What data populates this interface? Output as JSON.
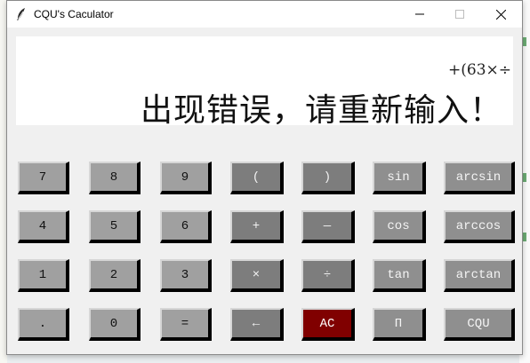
{
  "window": {
    "title": "CQU's Caculator",
    "controls": {
      "minimize": "—",
      "maximize": "☐",
      "close": "✕"
    }
  },
  "display": {
    "expression": "+(63×÷",
    "result": "出现错误，请重新输入！"
  },
  "keys": {
    "row1": [
      "7",
      "8",
      "9",
      "(",
      ")",
      "sin",
      "arcsin"
    ],
    "row2": [
      "4",
      "5",
      "6",
      "+",
      "—",
      "cos",
      "arccos"
    ],
    "row3": [
      "1",
      "2",
      "3",
      "×",
      "÷",
      "tan",
      "arctan"
    ],
    "row4": [
      ".",
      "0",
      "=",
      "←",
      "AC",
      "Π",
      "CQU"
    ]
  },
  "colors": {
    "digit_button": "#a0a0a0",
    "operator_button": "#7d7d7d",
    "function_button": "#8f8f8f",
    "clear_button": "#800000",
    "display_bg": "#ffffff"
  },
  "icons": {
    "title": "feather-icon"
  }
}
